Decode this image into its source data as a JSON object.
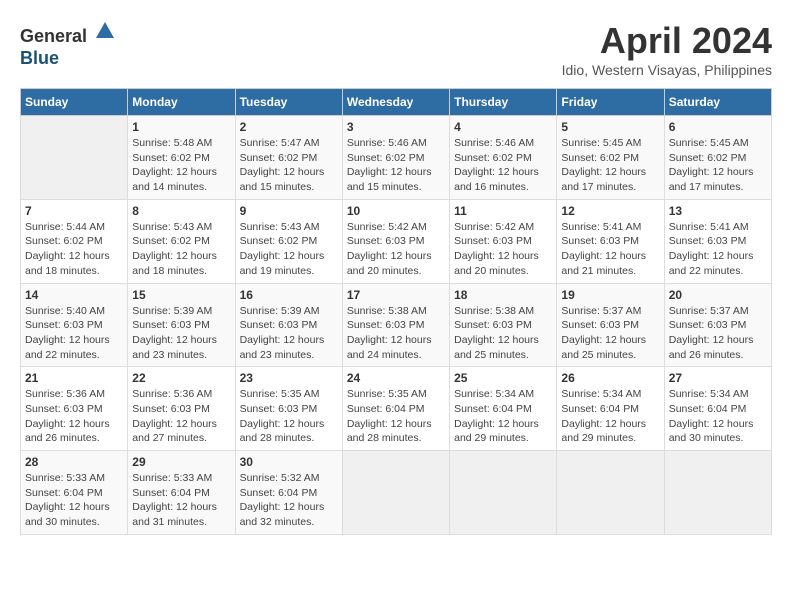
{
  "header": {
    "logo_line1": "General",
    "logo_line2": "Blue",
    "month_title": "April 2024",
    "location": "Idio, Western Visayas, Philippines"
  },
  "weekdays": [
    "Sunday",
    "Monday",
    "Tuesday",
    "Wednesday",
    "Thursday",
    "Friday",
    "Saturday"
  ],
  "weeks": [
    [
      {
        "day": "",
        "info": ""
      },
      {
        "day": "1",
        "info": "Sunrise: 5:48 AM\nSunset: 6:02 PM\nDaylight: 12 hours\nand 14 minutes."
      },
      {
        "day": "2",
        "info": "Sunrise: 5:47 AM\nSunset: 6:02 PM\nDaylight: 12 hours\nand 15 minutes."
      },
      {
        "day": "3",
        "info": "Sunrise: 5:46 AM\nSunset: 6:02 PM\nDaylight: 12 hours\nand 15 minutes."
      },
      {
        "day": "4",
        "info": "Sunrise: 5:46 AM\nSunset: 6:02 PM\nDaylight: 12 hours\nand 16 minutes."
      },
      {
        "day": "5",
        "info": "Sunrise: 5:45 AM\nSunset: 6:02 PM\nDaylight: 12 hours\nand 17 minutes."
      },
      {
        "day": "6",
        "info": "Sunrise: 5:45 AM\nSunset: 6:02 PM\nDaylight: 12 hours\nand 17 minutes."
      }
    ],
    [
      {
        "day": "7",
        "info": "Sunrise: 5:44 AM\nSunset: 6:02 PM\nDaylight: 12 hours\nand 18 minutes."
      },
      {
        "day": "8",
        "info": "Sunrise: 5:43 AM\nSunset: 6:02 PM\nDaylight: 12 hours\nand 18 minutes."
      },
      {
        "day": "9",
        "info": "Sunrise: 5:43 AM\nSunset: 6:02 PM\nDaylight: 12 hours\nand 19 minutes."
      },
      {
        "day": "10",
        "info": "Sunrise: 5:42 AM\nSunset: 6:03 PM\nDaylight: 12 hours\nand 20 minutes."
      },
      {
        "day": "11",
        "info": "Sunrise: 5:42 AM\nSunset: 6:03 PM\nDaylight: 12 hours\nand 20 minutes."
      },
      {
        "day": "12",
        "info": "Sunrise: 5:41 AM\nSunset: 6:03 PM\nDaylight: 12 hours\nand 21 minutes."
      },
      {
        "day": "13",
        "info": "Sunrise: 5:41 AM\nSunset: 6:03 PM\nDaylight: 12 hours\nand 22 minutes."
      }
    ],
    [
      {
        "day": "14",
        "info": "Sunrise: 5:40 AM\nSunset: 6:03 PM\nDaylight: 12 hours\nand 22 minutes."
      },
      {
        "day": "15",
        "info": "Sunrise: 5:39 AM\nSunset: 6:03 PM\nDaylight: 12 hours\nand 23 minutes."
      },
      {
        "day": "16",
        "info": "Sunrise: 5:39 AM\nSunset: 6:03 PM\nDaylight: 12 hours\nand 23 minutes."
      },
      {
        "day": "17",
        "info": "Sunrise: 5:38 AM\nSunset: 6:03 PM\nDaylight: 12 hours\nand 24 minutes."
      },
      {
        "day": "18",
        "info": "Sunrise: 5:38 AM\nSunset: 6:03 PM\nDaylight: 12 hours\nand 25 minutes."
      },
      {
        "day": "19",
        "info": "Sunrise: 5:37 AM\nSunset: 6:03 PM\nDaylight: 12 hours\nand 25 minutes."
      },
      {
        "day": "20",
        "info": "Sunrise: 5:37 AM\nSunset: 6:03 PM\nDaylight: 12 hours\nand 26 minutes."
      }
    ],
    [
      {
        "day": "21",
        "info": "Sunrise: 5:36 AM\nSunset: 6:03 PM\nDaylight: 12 hours\nand 26 minutes."
      },
      {
        "day": "22",
        "info": "Sunrise: 5:36 AM\nSunset: 6:03 PM\nDaylight: 12 hours\nand 27 minutes."
      },
      {
        "day": "23",
        "info": "Sunrise: 5:35 AM\nSunset: 6:03 PM\nDaylight: 12 hours\nand 28 minutes."
      },
      {
        "day": "24",
        "info": "Sunrise: 5:35 AM\nSunset: 6:04 PM\nDaylight: 12 hours\nand 28 minutes."
      },
      {
        "day": "25",
        "info": "Sunrise: 5:34 AM\nSunset: 6:04 PM\nDaylight: 12 hours\nand 29 minutes."
      },
      {
        "day": "26",
        "info": "Sunrise: 5:34 AM\nSunset: 6:04 PM\nDaylight: 12 hours\nand 29 minutes."
      },
      {
        "day": "27",
        "info": "Sunrise: 5:34 AM\nSunset: 6:04 PM\nDaylight: 12 hours\nand 30 minutes."
      }
    ],
    [
      {
        "day": "28",
        "info": "Sunrise: 5:33 AM\nSunset: 6:04 PM\nDaylight: 12 hours\nand 30 minutes."
      },
      {
        "day": "29",
        "info": "Sunrise: 5:33 AM\nSunset: 6:04 PM\nDaylight: 12 hours\nand 31 minutes."
      },
      {
        "day": "30",
        "info": "Sunrise: 5:32 AM\nSunset: 6:04 PM\nDaylight: 12 hours\nand 32 minutes."
      },
      {
        "day": "",
        "info": ""
      },
      {
        "day": "",
        "info": ""
      },
      {
        "day": "",
        "info": ""
      },
      {
        "day": "",
        "info": ""
      }
    ]
  ]
}
